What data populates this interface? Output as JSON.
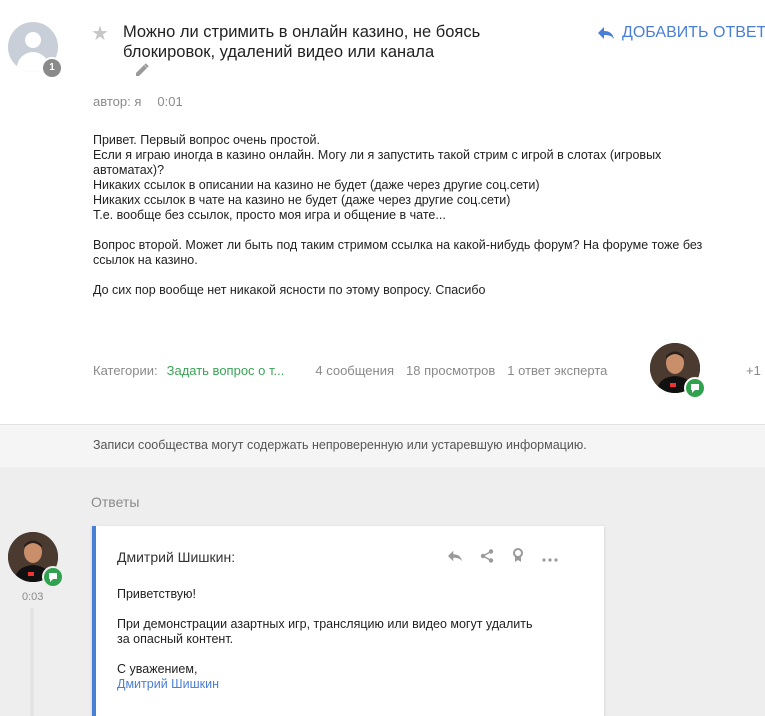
{
  "question": {
    "title": "Можно ли стримить в онлайн казино, не боясь блокировок, удалений видео или канала",
    "author_count_badge": "1",
    "add_answer_label": "ДОБАВИТЬ ОТВЕТ",
    "meta_author": "автор: я",
    "meta_time": "0:01",
    "body_paragraphs": [
      "Привет. Первый вопрос очень простой.\nЕсли я играю иногда в казино онлайн. Могу ли я запустить такой стрим с игрой в слотах (игровых автоматах)?\nНикаких ссылок в описании на казино не будет (даже через другие соц.сети)\nНикаких ссылок в чате на казино не будет (даже через другие соц.сети)\nТ.е. вообще без ссылок, просто моя игра и общение в чате...",
      "Вопрос второй. Может ли быть под таким стримом ссылка на какой-нибудь форум? На форуме тоже без ссылок на казино.",
      "До сих пор вообще нет никакой ясности по этому вопросу. Спасибо"
    ],
    "categories_label": "Категории:",
    "category_link": "Задать вопрос о т...",
    "messages_count": "4 сообщения",
    "views_count": "18 просмотров",
    "expert_answers": "1 ответ эксперта",
    "plus_one": "+1"
  },
  "notice": "Записи сообщества могут содержать непроверенную или устаревшую информацию.",
  "answers": {
    "label": "Ответы",
    "items": [
      {
        "time": "0:03",
        "author": "Дмитрий Шишкин:",
        "paragraphs": [
          "Приветствую!",
          "При демонстрации азартных игр, трансляцию или видео могут удалить за опасный контент."
        ],
        "sign_off": "С уважением,",
        "signature_name": "Дмитрий Шишкин"
      }
    ]
  },
  "colors": {
    "accent_blue": "#4a7fd6",
    "category_green": "#3aa457",
    "expert_badge_green": "#30a14e",
    "muted_text": "#8a8a8a"
  },
  "icons": [
    "person-icon",
    "star-icon",
    "pencil-icon",
    "reply-arrow-icon",
    "share-icon",
    "award-icon",
    "more-icon",
    "expert-badge-icon"
  ]
}
